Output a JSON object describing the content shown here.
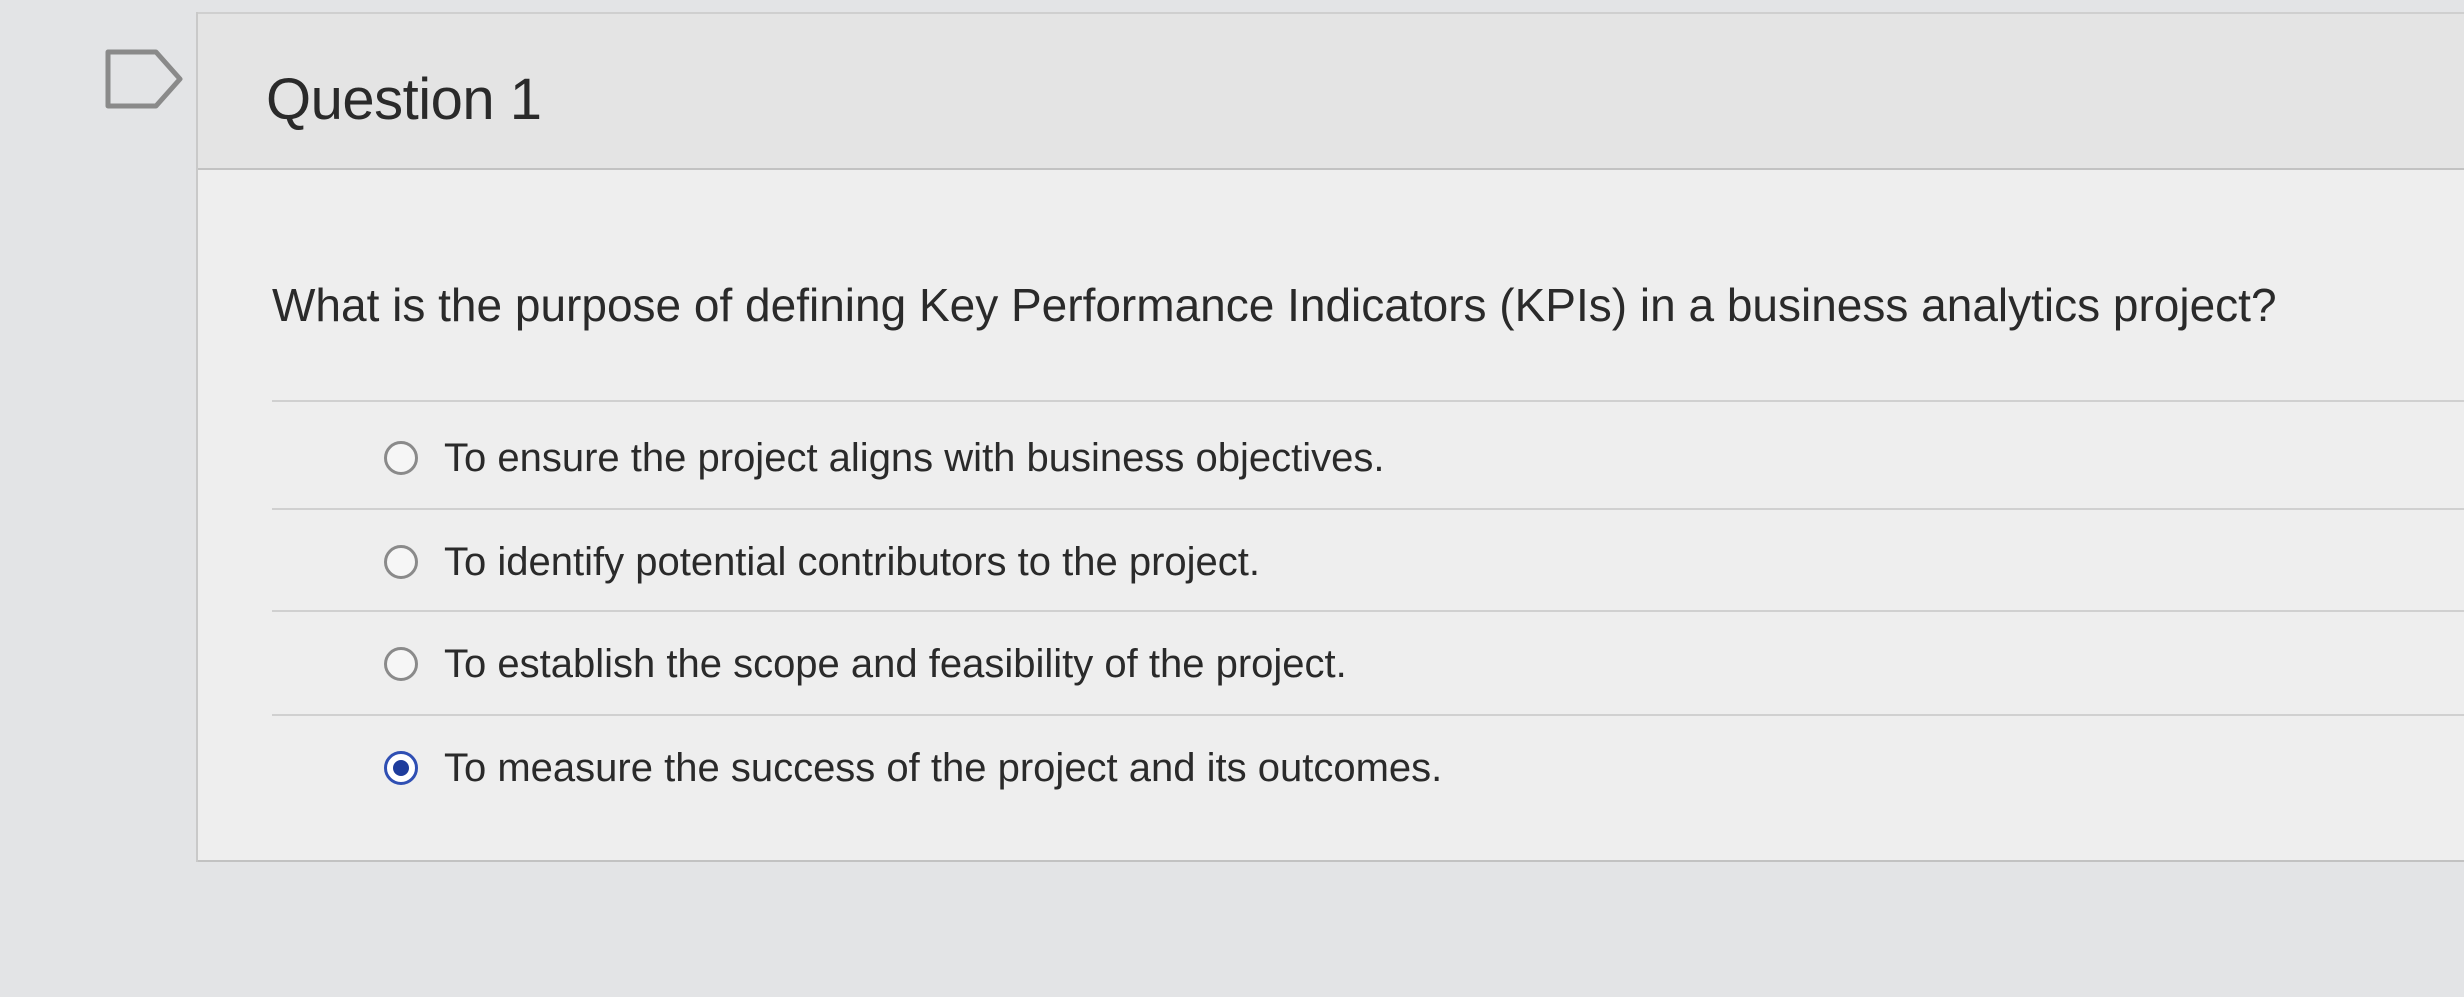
{
  "question": {
    "title": "Question 1",
    "prompt": "What is the purpose of defining Key Performance Indicators (KPIs) in a business analytics project?",
    "flag_icon": "flag-question-icon"
  },
  "answers": [
    {
      "label": "To ensure the project aligns with business objectives.",
      "selected": false
    },
    {
      "label": "To identify potential contributors to the project.",
      "selected": false
    },
    {
      "label": "To establish the scope and feasibility of the project.",
      "selected": false
    },
    {
      "label": "To measure the success of the project and its outcomes.",
      "selected": true
    }
  ],
  "colors": {
    "selected_radio": "#1e3c9c",
    "unselected_radio_border": "#8a8a8a"
  }
}
